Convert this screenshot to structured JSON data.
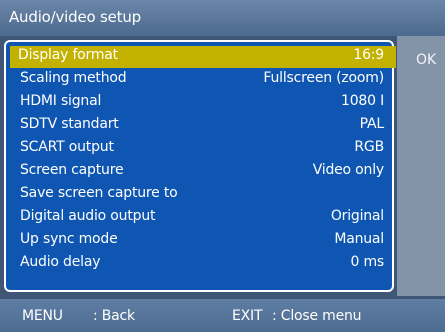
{
  "window": {
    "title": "Audio/video setup"
  },
  "side": {
    "ok_label": "OK"
  },
  "menu": {
    "items": [
      {
        "label": "Display format",
        "value": "16:9",
        "selected": true
      },
      {
        "label": "Scaling method",
        "value": "Fullscreen (zoom)"
      },
      {
        "label": "HDMI signal",
        "value": "1080 I"
      },
      {
        "label": "SDTV standart",
        "value": "PAL"
      },
      {
        "label": "SCART output",
        "value": "RGB"
      },
      {
        "label": "Screen capture",
        "value": "Video only"
      },
      {
        "label": "Save screen capture to",
        "value": ""
      },
      {
        "label": "Digital audio output",
        "value": "Original"
      },
      {
        "label": "Up sync mode",
        "value": "Manual"
      },
      {
        "label": "Audio delay",
        "value": "0 ms"
      }
    ]
  },
  "footer": {
    "menu_key": "MENU",
    "menu_action": ": Back",
    "exit_key": "EXIT",
    "exit_action": ": Close menu"
  },
  "colors": {
    "menu_background": "#0e56b1",
    "selected_row": "#c3b100",
    "title_bar": "#5d7aa0",
    "side_panel": "#8494a8"
  }
}
